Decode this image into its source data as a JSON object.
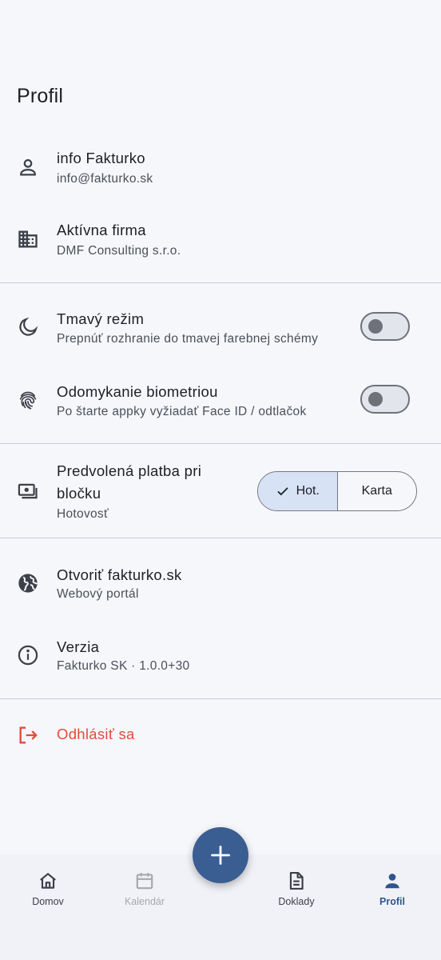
{
  "header": {
    "title": "Profil"
  },
  "account": {
    "name": "info Fakturko",
    "email": "info@fakturko.sk"
  },
  "company": {
    "title": "Aktívna firma",
    "name": "DMF Consulting s.r.o."
  },
  "dark_mode": {
    "title": "Tmavý režim",
    "subtitle": "Prepnúť rozhranie do tmavej farebnej schémy",
    "enabled": false
  },
  "biometric": {
    "title": "Odomykanie biometriou",
    "subtitle": "Po štarte appky vyžiadať Face ID / odtlačok",
    "enabled": false
  },
  "payment": {
    "title_line1": "Predvolená platba pri",
    "title_line2": "bločku",
    "subtitle": "Hotovosť",
    "options": [
      "Hot.",
      "Karta"
    ],
    "selected": "Hot."
  },
  "website": {
    "title": "Otvoriť fakturko.sk",
    "subtitle": "Webový portál"
  },
  "version": {
    "title": "Verzia",
    "subtitle": "Fakturko SK · 1.0.0+30"
  },
  "logout": {
    "label": "Odhlásiť sa"
  },
  "nav": {
    "home": "Domov",
    "calendar": "Kalendár",
    "documents": "Doklady",
    "profile": "Profil"
  },
  "colors": {
    "accent": "#3a5e92",
    "danger": "#e34a3c",
    "selected_bg": "#d8e2f5"
  },
  "icons": [
    "person-icon",
    "building-icon",
    "moon-icon",
    "fingerprint-icon",
    "money-icon",
    "globe-icon",
    "info-icon",
    "logout-icon",
    "home-icon",
    "calendar-icon",
    "document-icon",
    "profile-icon",
    "plus-icon"
  ]
}
